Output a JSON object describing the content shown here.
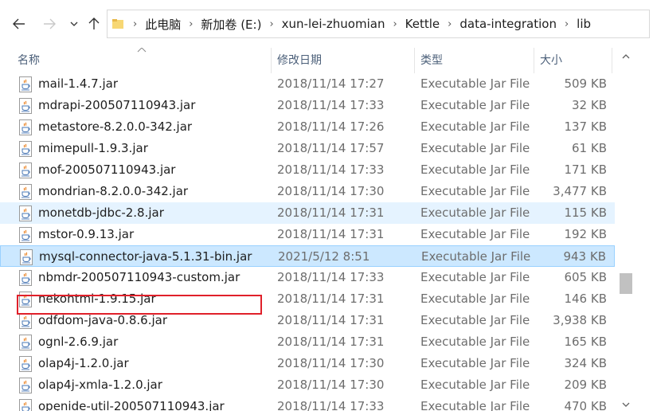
{
  "address": {
    "crumbs": [
      "此电脑",
      "新加卷 (E:)",
      "xun-lei-zhuomian",
      "Kettle",
      "data-integration",
      "lib"
    ]
  },
  "columns": {
    "name": "名称",
    "date": "修改日期",
    "type": "类型",
    "size": "大小"
  },
  "files": [
    {
      "name": "mail-1.4.7.jar",
      "date": "2018/11/14 17:27",
      "type": "Executable Jar File",
      "size": "509 KB"
    },
    {
      "name": "mdrapi-200507110943.jar",
      "date": "2018/11/14 17:33",
      "type": "Executable Jar File",
      "size": "32 KB"
    },
    {
      "name": "metastore-8.2.0.0-342.jar",
      "date": "2018/11/14 17:26",
      "type": "Executable Jar File",
      "size": "137 KB"
    },
    {
      "name": "mimepull-1.9.3.jar",
      "date": "2018/11/14 17:57",
      "type": "Executable Jar File",
      "size": "61 KB"
    },
    {
      "name": "mof-200507110943.jar",
      "date": "2018/11/14 17:33",
      "type": "Executable Jar File",
      "size": "171 KB"
    },
    {
      "name": "mondrian-8.2.0.0-342.jar",
      "date": "2018/11/14 17:30",
      "type": "Executable Jar File",
      "size": "3,477 KB"
    },
    {
      "name": "monetdb-jdbc-2.8.jar",
      "date": "2018/11/14 17:31",
      "type": "Executable Jar File",
      "size": "115 KB"
    },
    {
      "name": "mstor-0.9.13.jar",
      "date": "2018/11/14 17:31",
      "type": "Executable Jar File",
      "size": "192 KB"
    },
    {
      "name": "mysql-connector-java-5.1.31-bin.jar",
      "date": "2021/5/12 8:51",
      "type": "Executable Jar File",
      "size": "943 KB"
    },
    {
      "name": "nbmdr-200507110943-custom.jar",
      "date": "2018/11/14 17:33",
      "type": "Executable Jar File",
      "size": "605 KB"
    },
    {
      "name": "nekohtml-1.9.15.jar",
      "date": "2018/11/14 17:31",
      "type": "Executable Jar File",
      "size": "146 KB"
    },
    {
      "name": "odfdom-java-0.8.6.jar",
      "date": "2018/11/14 17:31",
      "type": "Executable Jar File",
      "size": "3,938 KB"
    },
    {
      "name": "ognl-2.6.9.jar",
      "date": "2018/11/14 17:31",
      "type": "Executable Jar File",
      "size": "165 KB"
    },
    {
      "name": "olap4j-1.2.0.jar",
      "date": "2018/11/14 17:30",
      "type": "Executable Jar File",
      "size": "324 KB"
    },
    {
      "name": "olap4j-xmla-1.2.0.jar",
      "date": "2018/11/14 17:30",
      "type": "Executable Jar File",
      "size": "209 KB"
    },
    {
      "name": "openide-util-200507110943.jar",
      "date": "2018/11/14 17:33",
      "type": "Executable Jar File",
      "size": "470 KB"
    }
  ],
  "hover_index": 6,
  "selected_index": 8,
  "icons": {
    "back": "arrow-left-icon",
    "forward": "arrow-right-icon",
    "recent": "chevron-down-icon",
    "up": "arrow-up-icon",
    "folder": "folder-icon",
    "file": "java-jar-icon"
  },
  "colors": {
    "hover": "#e5f3ff",
    "selected": "#cce8ff",
    "annotation": "#e0202a"
  }
}
